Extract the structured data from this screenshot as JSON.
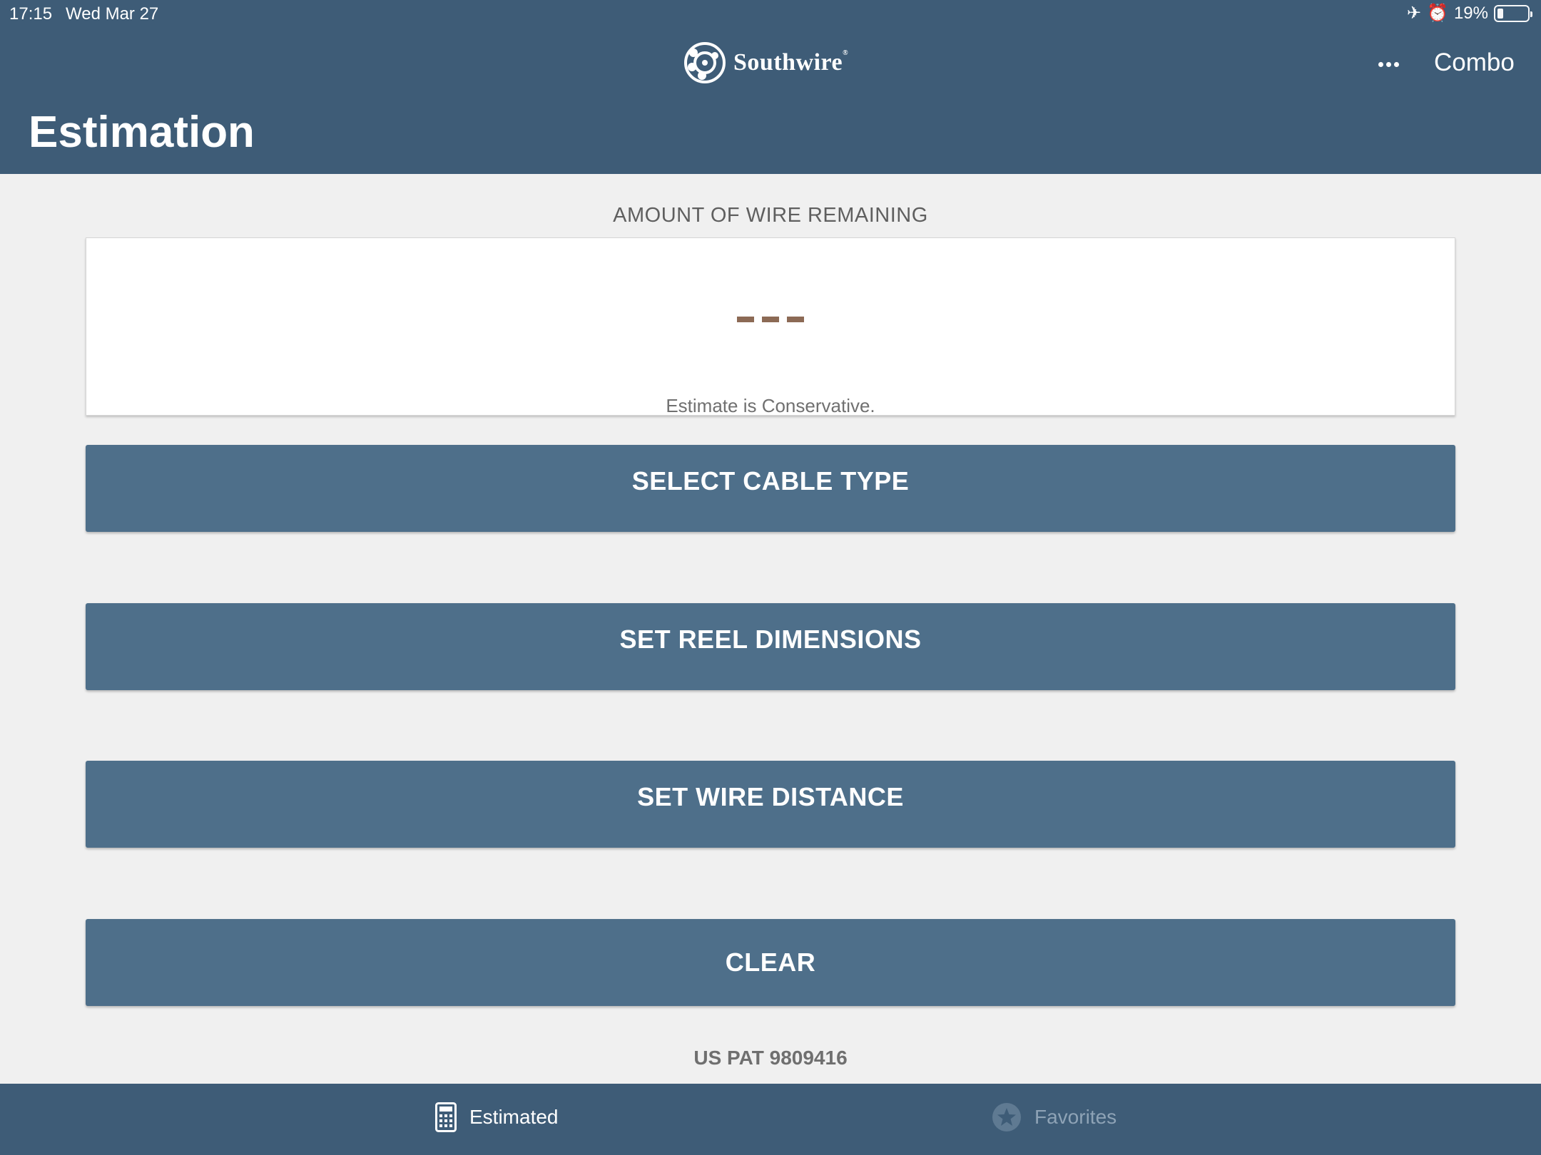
{
  "status_bar": {
    "time": "17:15",
    "date": "Wed Mar 27",
    "battery": "19%",
    "battery_level": 0.19,
    "icons": [
      "airplane-icon",
      "alarm-icon",
      "battery-icon"
    ]
  },
  "header": {
    "brand": "Southwire",
    "brand_mark": "®",
    "more_icon": "ellipsis-icon",
    "combo_label": "Combo",
    "title": "Estimation"
  },
  "result": {
    "label": "AMOUNT OF WIRE REMAINING",
    "value": "---",
    "note": "Estimate is Conservative."
  },
  "actions": {
    "select_cable": "SELECT CABLE TYPE",
    "set_reel": "SET REEL DIMENSIONS",
    "set_distance": "SET WIRE DISTANCE",
    "clear": "CLEAR"
  },
  "patent": "US PAT 9809416",
  "tabs": [
    {
      "label": "Estimated",
      "icon": "calculator-icon",
      "active": true
    },
    {
      "label": "Favorites",
      "icon": "star-icon",
      "active": false
    }
  ],
  "colors": {
    "header_bg": "#3e5c77",
    "button_bg": "#4e6f8a",
    "page_bg": "#f0f0f0",
    "dash": "#8c6a55",
    "tab_inactive": "#8ea3b6"
  }
}
